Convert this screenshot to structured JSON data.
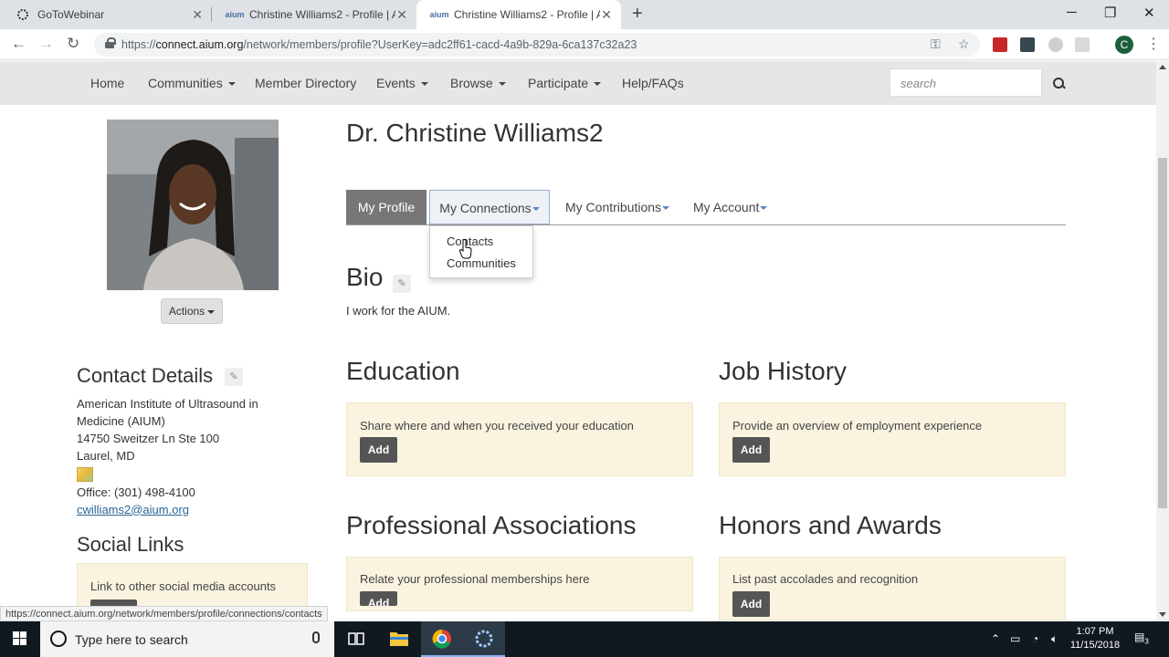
{
  "browser": {
    "tabs": [
      {
        "title": "GoToWebinar",
        "active": false
      },
      {
        "title": "Christine Williams2 - Profile | AIUM",
        "active": false
      },
      {
        "title": "Christine Williams2 - Profile | AIUM",
        "active": true
      }
    ],
    "url_prefix": "https://",
    "url_host": "connect.aium.org",
    "url_path": "/network/members/profile?UserKey=adc2ff61-cacd-4a9b-829a-6ca137c32a23",
    "profile_initial": "C",
    "status_url": "https://connect.aium.org/network/members/profile/connections/contacts"
  },
  "nav": {
    "items": [
      {
        "label": "Home",
        "dropdown": false
      },
      {
        "label": "Communities",
        "dropdown": true
      },
      {
        "label": "Member Directory",
        "dropdown": false
      },
      {
        "label": "Events",
        "dropdown": true
      },
      {
        "label": "Browse",
        "dropdown": true
      },
      {
        "label": "Participate",
        "dropdown": true
      },
      {
        "label": "Help/FAQs",
        "dropdown": false
      }
    ],
    "search_placeholder": "search"
  },
  "sidebar": {
    "actions_label": "Actions",
    "contact_title": "Contact Details",
    "address_lines": [
      "American Institute of Ultrasound in Medicine (AIUM)",
      "14750 Sweitzer Ln Ste 100",
      "Laurel, MD"
    ],
    "phone": "Office: (301) 498-4100",
    "email": "cwilliams2@aium.org",
    "social_title": "Social Links",
    "social_prompt": "Link to other social media accounts"
  },
  "profile": {
    "name": "Dr. Christine Williams2",
    "tabs": {
      "my_profile": "My Profile",
      "my_connections": "My Connections",
      "my_contributions": "My Contributions",
      "my_account": "My Account"
    },
    "dropdown_items": [
      "Contacts",
      "Communities"
    ],
    "bio_title": "Bio",
    "bio_text": "I work for the AIUM.",
    "sections": {
      "education": {
        "title": "Education",
        "prompt": "Share where and when you received your education",
        "button": "Add"
      },
      "job_history": {
        "title": "Job History",
        "prompt": "Provide an overview of employment experience",
        "button": "Add"
      },
      "prof_assoc": {
        "title": "Professional Associations",
        "prompt": "Relate your professional memberships here",
        "button": "Add"
      },
      "honors": {
        "title": "Honors and Awards",
        "prompt": "List past accolades and recognition",
        "button": "Add"
      }
    }
  },
  "taskbar": {
    "search_placeholder": "Type here to search",
    "time": "1:07 PM",
    "date": "11/15/2018",
    "notification_count": "3"
  },
  "colors": {
    "nav_bg": "#e6e6e6",
    "callout_bg": "#faf3df",
    "active_tab_bg": "#777777",
    "link_blue": "#2a6496",
    "taskbar_bg": "#101820"
  }
}
